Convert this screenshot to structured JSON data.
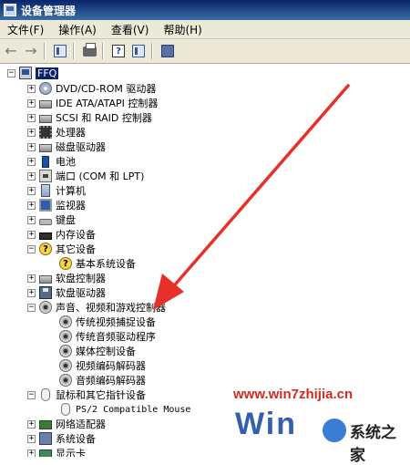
{
  "window": {
    "title": "设备管理器"
  },
  "menu": [
    "文件(F)",
    "操作(A)",
    "查看(V)",
    "帮助(H)"
  ],
  "toolbar": {
    "back_icon": "back-arrow-icon",
    "forward_icon": "forward-arrow-icon"
  },
  "tree": {
    "root": "FFQ",
    "items": [
      {
        "label": "DVD/CD-ROM 驱动器",
        "icon": "disc-drive-icon"
      },
      {
        "label": "IDE ATA/ATAPI 控制器",
        "icon": "ide-controller-icon"
      },
      {
        "label": "SCSI 和 RAID 控制器",
        "icon": "scsi-controller-icon"
      },
      {
        "label": "处理器",
        "icon": "processor-icon"
      },
      {
        "label": "磁盘驱动器",
        "icon": "disk-drive-icon"
      },
      {
        "label": "电池",
        "icon": "battery-icon"
      },
      {
        "label": "端口 (COM 和 LPT)",
        "icon": "port-icon"
      },
      {
        "label": "计算机",
        "icon": "computer-icon"
      },
      {
        "label": "监视器",
        "icon": "monitor-icon"
      },
      {
        "label": "键盘",
        "icon": "keyboard-icon"
      },
      {
        "label": "内存设备",
        "icon": "memory-icon"
      },
      {
        "label": "其它设备",
        "icon": "unknown-device-icon"
      },
      {
        "label": "基本系统设备",
        "icon": "warning-device-icon"
      },
      {
        "label": "软盘控制器",
        "icon": "floppy-controller-icon"
      },
      {
        "label": "软盘驱动器",
        "icon": "floppy-drive-icon"
      },
      {
        "label": "声音、视频和游戏控制器",
        "icon": "speaker-icon"
      },
      {
        "label": "传统视频捕捉设备",
        "icon": "speaker-icon"
      },
      {
        "label": "传统音频驱动程序",
        "icon": "speaker-icon"
      },
      {
        "label": "媒体控制设备",
        "icon": "speaker-icon"
      },
      {
        "label": "视频编码解码器",
        "icon": "speaker-icon"
      },
      {
        "label": "音频编码解码器",
        "icon": "speaker-icon"
      },
      {
        "label": "鼠标和其它指针设备",
        "icon": "mouse-icon"
      },
      {
        "label": "PS/2 Compatible Mouse",
        "icon": "mouse-icon"
      },
      {
        "label": "网络适配器",
        "icon": "network-adapter-icon"
      },
      {
        "label": "系统设备",
        "icon": "system-device-icon"
      },
      {
        "label": "显示卡",
        "icon": "display-card-icon"
      }
    ]
  },
  "watermark": {
    "url": "www.win7zhijia.cn",
    "big": "Win",
    "cn": "系统之家"
  },
  "colors": {
    "title_gradient_start": "#0a246a",
    "title_gradient_end": "#3a6ea5",
    "chrome": "#ece9d8",
    "arrow": "#e8302a"
  }
}
